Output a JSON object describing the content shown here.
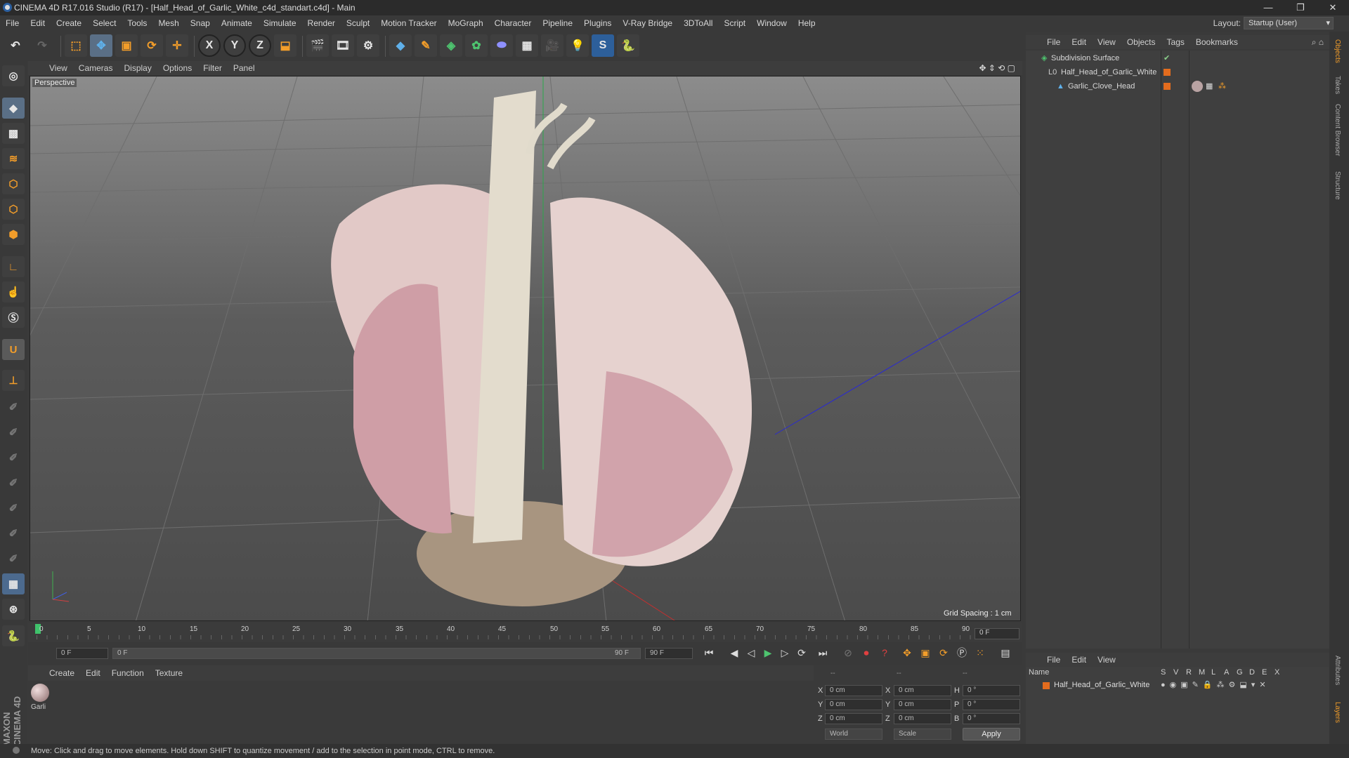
{
  "window": {
    "title": "CINEMA 4D R17.016 Studio (R17) - [Half_Head_of_Garlic_White_c4d_standart.c4d] - Main",
    "controls": [
      "—",
      "❐",
      "✕"
    ]
  },
  "menubar": [
    "File",
    "Edit",
    "Create",
    "Select",
    "Tools",
    "Mesh",
    "Snap",
    "Animate",
    "Simulate",
    "Render",
    "Sculpt",
    "Motion Tracker",
    "MoGraph",
    "Character",
    "Pipeline",
    "Plugins",
    "V-Ray Bridge",
    "3DToAll",
    "Script",
    "Window",
    "Help"
  ],
  "layout": {
    "label": "Layout:",
    "value": "Startup (User)"
  },
  "viewport": {
    "menu": [
      "View",
      "Cameras",
      "Display",
      "Options",
      "Filter",
      "Panel"
    ],
    "label": "Perspective",
    "grid_spacing": "Grid Spacing : 1 cm"
  },
  "timeline": {
    "ticks": [
      "0",
      "5",
      "10",
      "15",
      "20",
      "25",
      "30",
      "35",
      "40",
      "45",
      "50",
      "55",
      "60",
      "65",
      "70",
      "75",
      "80",
      "85",
      "90"
    ],
    "current": "0 F"
  },
  "playbar": {
    "start": "0 F",
    "range_start": "0 F",
    "range_end": "90 F",
    "end": "90 F"
  },
  "material": {
    "menu": [
      "Create",
      "Edit",
      "Function",
      "Texture"
    ],
    "item": "Garli"
  },
  "coords": {
    "headers": [
      "--",
      "--",
      "--"
    ],
    "rows": [
      [
        "X",
        "0 cm",
        "X",
        "0 cm",
        "H",
        "0 °"
      ],
      [
        "Y",
        "0 cm",
        "Y",
        "0 cm",
        "P",
        "0 °"
      ],
      [
        "Z",
        "0 cm",
        "Z",
        "0 cm",
        "B",
        "0 °"
      ]
    ],
    "world": "World",
    "scale": "Scale",
    "apply": "Apply"
  },
  "objects": {
    "menu": [
      "File",
      "Edit",
      "View",
      "Objects",
      "Tags",
      "Bookmarks"
    ],
    "items": [
      "Subdivision Surface",
      "Half_Head_of_Garlic_White",
      "Garlic_Clove_Head"
    ]
  },
  "attributes": {
    "menu": [
      "File",
      "Edit",
      "View"
    ],
    "col_name": "Name",
    "cols": [
      "S",
      "V",
      "R",
      "M",
      "L",
      "A",
      "G",
      "D",
      "E",
      "X"
    ],
    "row": "Half_Head_of_Garlic_White"
  },
  "right_tabs": [
    "Objects",
    "Takes",
    "Content Browser",
    "Structure",
    "Attributes",
    "Layers"
  ],
  "brand": "MAXON CINEMA 4D",
  "status": "Move: Click and drag to move elements. Hold down SHIFT to quantize movement / add to the selection in point mode, CTRL to remove."
}
